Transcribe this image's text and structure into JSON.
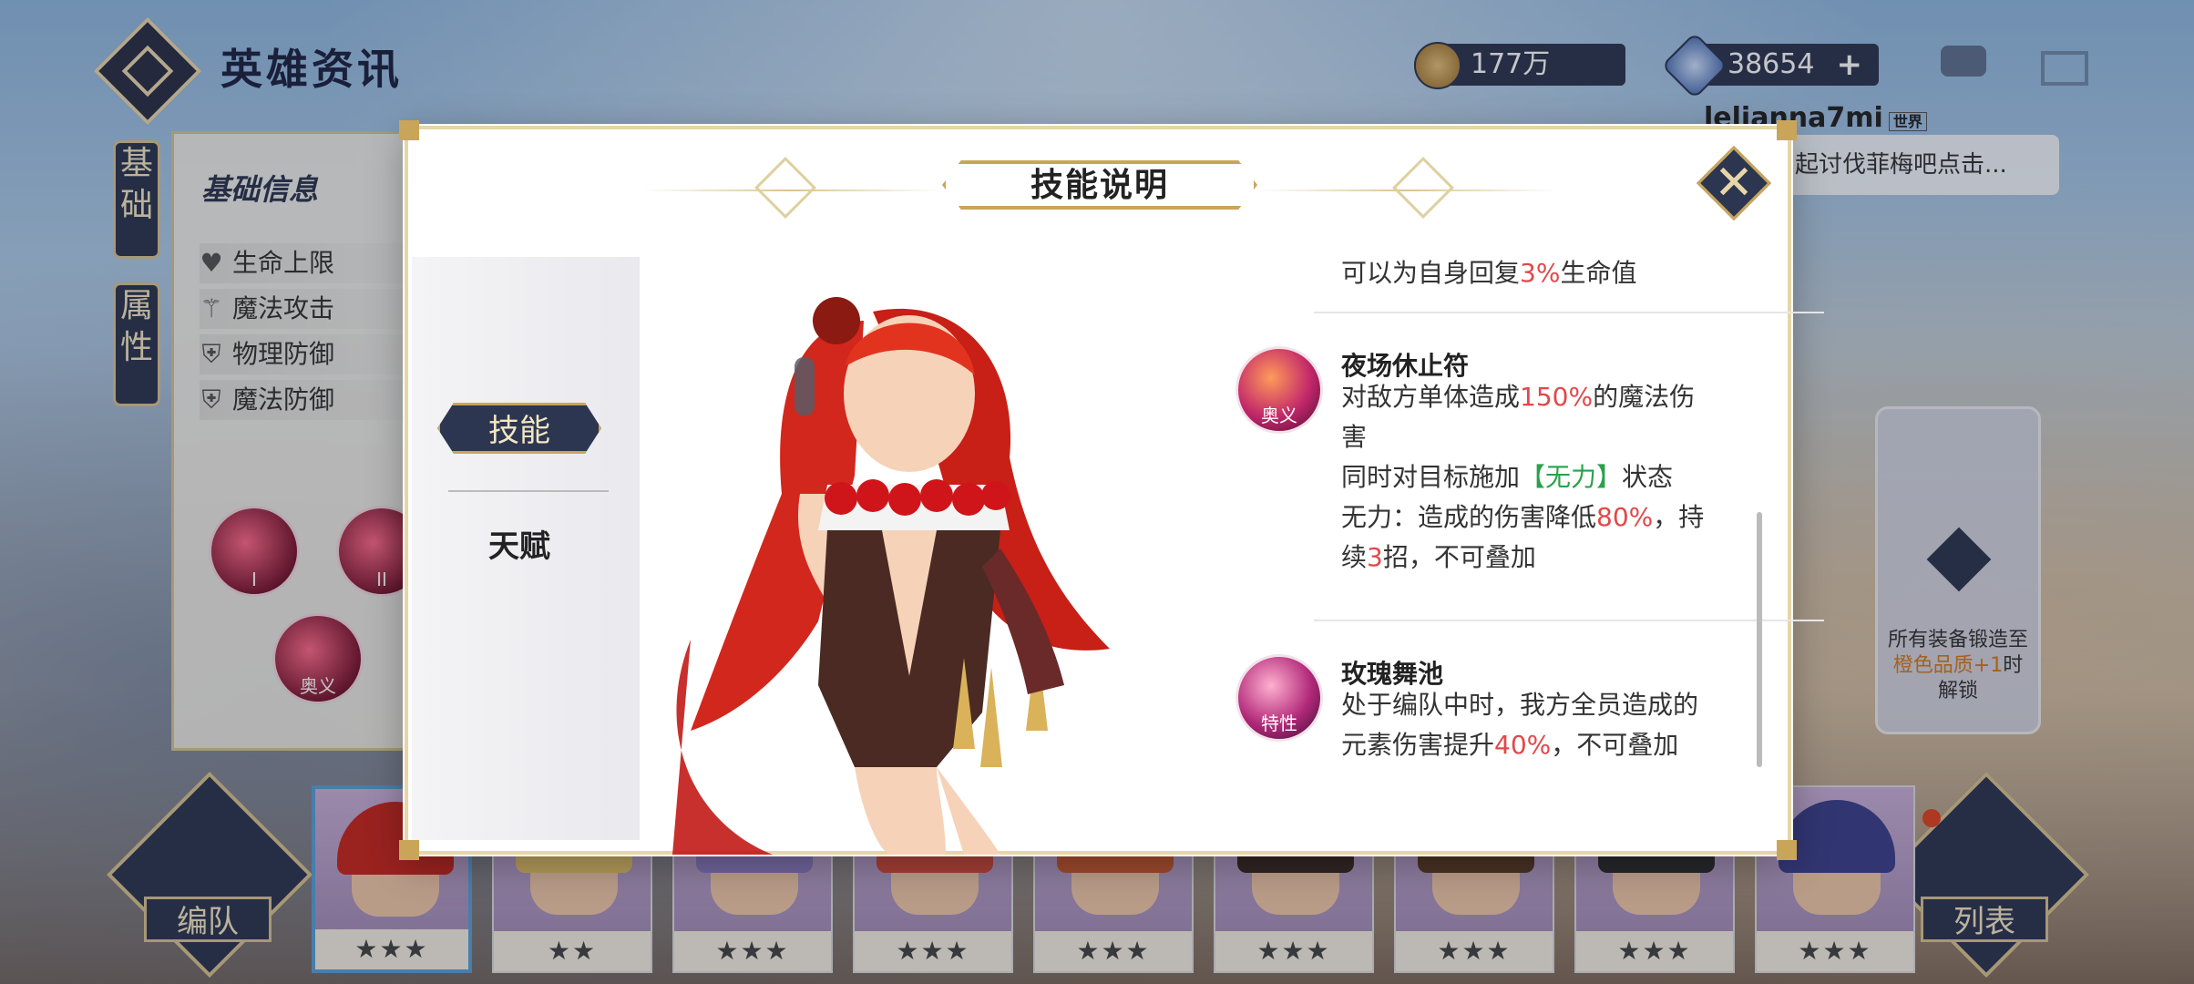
{
  "header": {
    "title": "英雄资讯",
    "gold": "177万",
    "gems": "38654",
    "gems_plus": "+"
  },
  "side_tabs": {
    "basic": "基础",
    "attr": "属性"
  },
  "info_panel": {
    "title": "基础信息",
    "stats": [
      {
        "icon": "heart-icon",
        "label": "生命上限"
      },
      {
        "icon": "wand-icon",
        "label": "魔法攻击"
      },
      {
        "icon": "shield-icon",
        "label": "物理防御"
      },
      {
        "icon": "magic-shield-icon",
        "label": "魔法防御"
      }
    ],
    "skill_orbs": [
      "I",
      "II",
      "奥义"
    ]
  },
  "player": {
    "name": "lelianna7mi",
    "world_tag": "世界",
    "message": "起讨伐菲梅吧点击..."
  },
  "lock_card": {
    "text_pre": "所有装备锻造至",
    "text_hl": "橙色品质+1",
    "text_post": "时解锁"
  },
  "bottom": {
    "team_label": "编队",
    "list_label": "列表",
    "heroes": [
      {
        "stars": "★★★",
        "selected": true,
        "hair": "#c7261c"
      },
      {
        "stars": "★★",
        "selected": false,
        "hair": "#e7c46a"
      },
      {
        "stars": "★★★",
        "selected": false,
        "hair": "#8d7cc0"
      },
      {
        "stars": "★★★",
        "selected": false,
        "hair": "#d24b3a"
      },
      {
        "stars": "★★★",
        "selected": false,
        "hair": "#c95a2e"
      },
      {
        "stars": "★★★",
        "selected": false,
        "hair": "#3a2a22"
      },
      {
        "stars": "★★★",
        "selected": false,
        "hair": "#5a3a22"
      },
      {
        "stars": "★★★",
        "selected": false,
        "hair": "#2c2c2c"
      },
      {
        "stars": "★★★",
        "selected": false,
        "hair": "#3b3f8a"
      }
    ]
  },
  "modal": {
    "title": "技能说明",
    "tabs": {
      "active": "技能",
      "inactive": "天赋"
    },
    "top_text_pre": "可以为自身回复",
    "top_text_hl": "3%",
    "top_text_post": "生命值",
    "skills": [
      {
        "name": "夜场休止符",
        "badge": "奥义",
        "l1_pre": "对敌方单体造成",
        "l1_hl": "150%",
        "l1_post": "的魔法伤",
        "l2": "害",
        "l3_pre": "同时对目标施加",
        "l3_hl": "【无力】",
        "l3_post": "状态",
        "l4_pre": "无力：造成的伤害降低",
        "l4_hl": "80%",
        "l4_post": "，持",
        "l5_pre": "续",
        "l5_hl": "3",
        "l5_post": "招，不可叠加"
      },
      {
        "name": "玫瑰舞池",
        "badge": "特性",
        "l1": "处于编队中时，我方全员造成的",
        "l2_pre": "元素伤害提升",
        "l2_hl": "40%",
        "l2_post": "，不可叠加"
      }
    ]
  },
  "colors": {
    "navy": "#2c3650",
    "gold": "#c9a55a",
    "highlight_red": "#e3474a",
    "highlight_green": "#2aa14a"
  }
}
